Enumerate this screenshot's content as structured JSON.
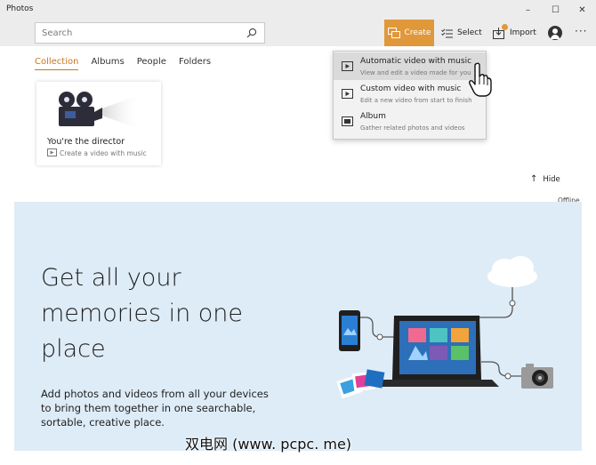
{
  "window": {
    "title": "Photos"
  },
  "window_controls": {
    "minimize": "–",
    "maximize": "☐",
    "close": "✕"
  },
  "toolbar": {
    "search_placeholder": "Search",
    "create_label": "Create",
    "select_label": "Select",
    "import_label": "Import",
    "more_label": "···"
  },
  "nav": {
    "tabs": [
      "Collection",
      "Albums",
      "People",
      "Folders"
    ],
    "active": "Collection"
  },
  "create_menu": {
    "items": [
      {
        "label": "Automatic video with music",
        "description": "View and edit a video made for you",
        "icon": "video-icon"
      },
      {
        "label": "Custom video with music",
        "description": "Edit a new video from start to finish",
        "icon": "video-icon"
      },
      {
        "label": "Album",
        "description": "Gather related photos and videos",
        "icon": "album-icon"
      }
    ]
  },
  "director_card": {
    "title": "You're the director",
    "subtitle": "Create a video with music"
  },
  "hide_label": "Hide",
  "offline_label": "Offline",
  "hero": {
    "title_lines": [
      "Get all your",
      "memories in one",
      "place"
    ],
    "body": "Add photos and videos from all your devices to bring them together in one searchable, sortable, creative place."
  },
  "watermark": "双电网 (www. pcpc. me)",
  "colors": {
    "accent": "#e0983b",
    "hero_bg": "#deecf7",
    "toolbar_bg": "#ececec"
  }
}
